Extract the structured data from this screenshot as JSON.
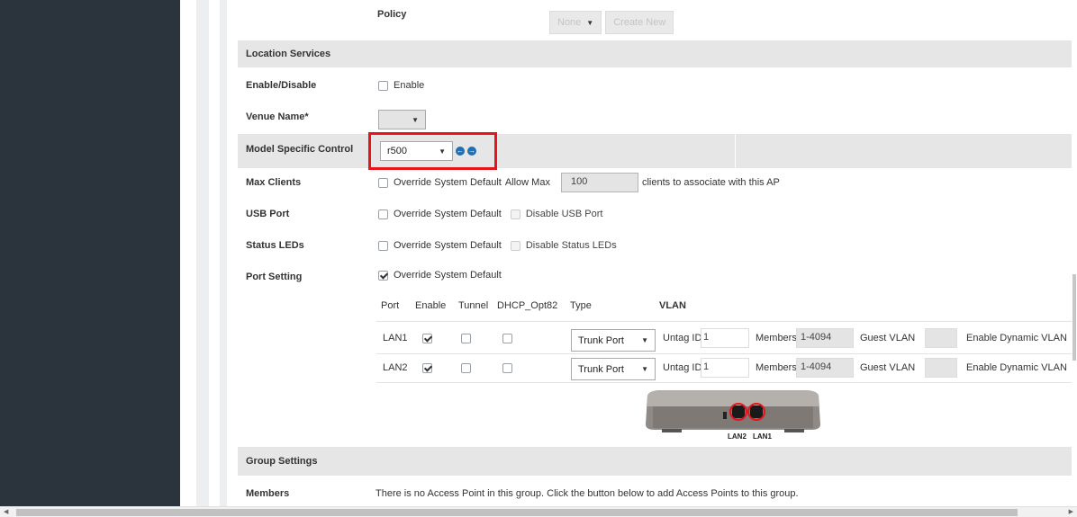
{
  "policy": {
    "label": "Policy",
    "select_value": "None",
    "create_button": "Create New"
  },
  "location_services": {
    "section_title": "Location Services",
    "enable_label": "Enable/Disable",
    "enable_text": "Enable",
    "venue_label": "Venue Name*",
    "venue_value": ""
  },
  "model_control": {
    "label": "Model Specific Control",
    "model_value": "r500"
  },
  "max_clients": {
    "label": "Max Clients",
    "override_text": "Override System Default",
    "allow_text": "Allow Max",
    "value": "100",
    "suffix": "clients to associate with this AP"
  },
  "usb_port": {
    "label": "USB Port",
    "override_text": "Override System Default",
    "disable_text": "Disable USB Port"
  },
  "status_leds": {
    "label": "Status LEDs",
    "override_text": "Override System Default",
    "disable_text": "Disable Status LEDs"
  },
  "port_setting": {
    "label": "Port Setting",
    "override_text": "Override System Default",
    "headers": {
      "port": "Port",
      "enable": "Enable",
      "tunnel": "Tunnel",
      "dhcp": "DHCP_Opt82",
      "type": "Type",
      "vlan": "VLAN"
    },
    "rows": [
      {
        "port": "LAN1",
        "type": "Trunk Port",
        "untag_label": "Untag ID",
        "untag_value": "1",
        "members_label": "Members",
        "members_value": "1-4094",
        "guest_label": "Guest VLAN",
        "dynamic_label": "Enable Dynamic VLAN"
      },
      {
        "port": "LAN2",
        "type": "Trunk Port",
        "untag_label": "Untag ID",
        "untag_value": "1",
        "members_label": "Members",
        "members_value": "1-4094",
        "guest_label": "Guest VLAN",
        "dynamic_label": "Enable Dynamic VLAN"
      }
    ],
    "image_labels": {
      "lan2": "LAN2",
      "lan1": "LAN1"
    }
  },
  "group_settings": {
    "section_title": "Group Settings",
    "members_label": "Members",
    "members_text": "There is no Access Point in this group. Click the button below to add Access Points to this group."
  },
  "colors": {
    "sidebar": "#2b333d",
    "section_gray": "#e6e6e6",
    "highlight": "#e8141b",
    "accent_blue": "#1f6fb7"
  }
}
